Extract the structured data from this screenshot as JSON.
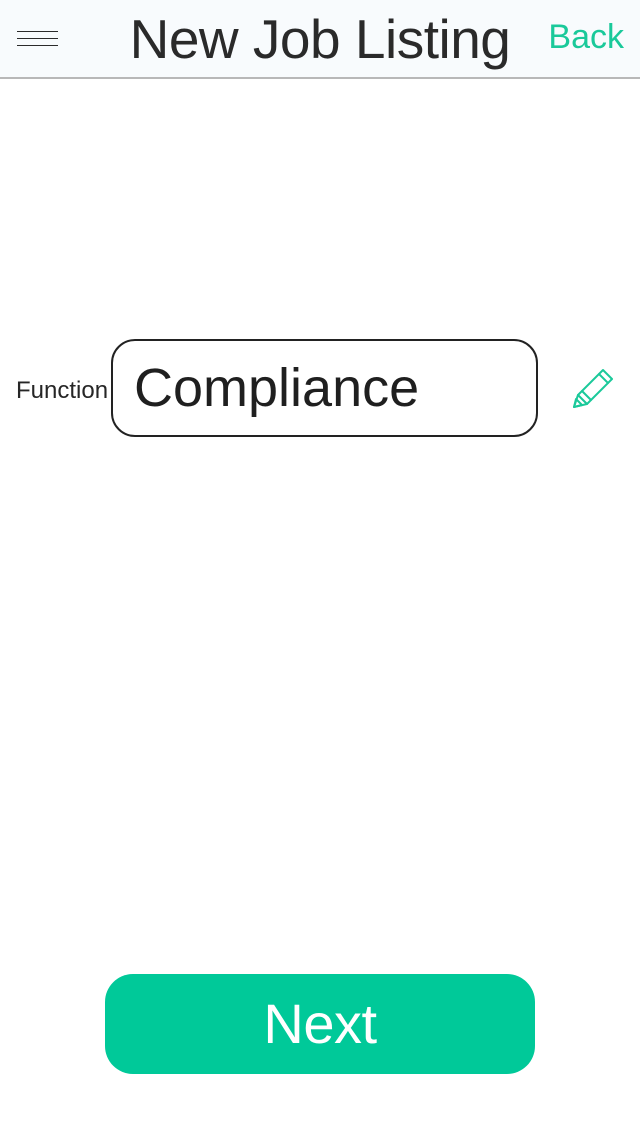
{
  "header": {
    "title": "New Job Listing",
    "back_label": "Back",
    "menu_icon": "hamburger-menu-icon"
  },
  "form": {
    "function_label": "Function",
    "function_value": "Compliance",
    "edit_icon": "pencil-icon"
  },
  "footer": {
    "next_label": "Next"
  },
  "colors": {
    "accent": "#00c999",
    "back_text": "#1ac99a",
    "nav_background": "#f8fbfd",
    "border": "#222222"
  }
}
